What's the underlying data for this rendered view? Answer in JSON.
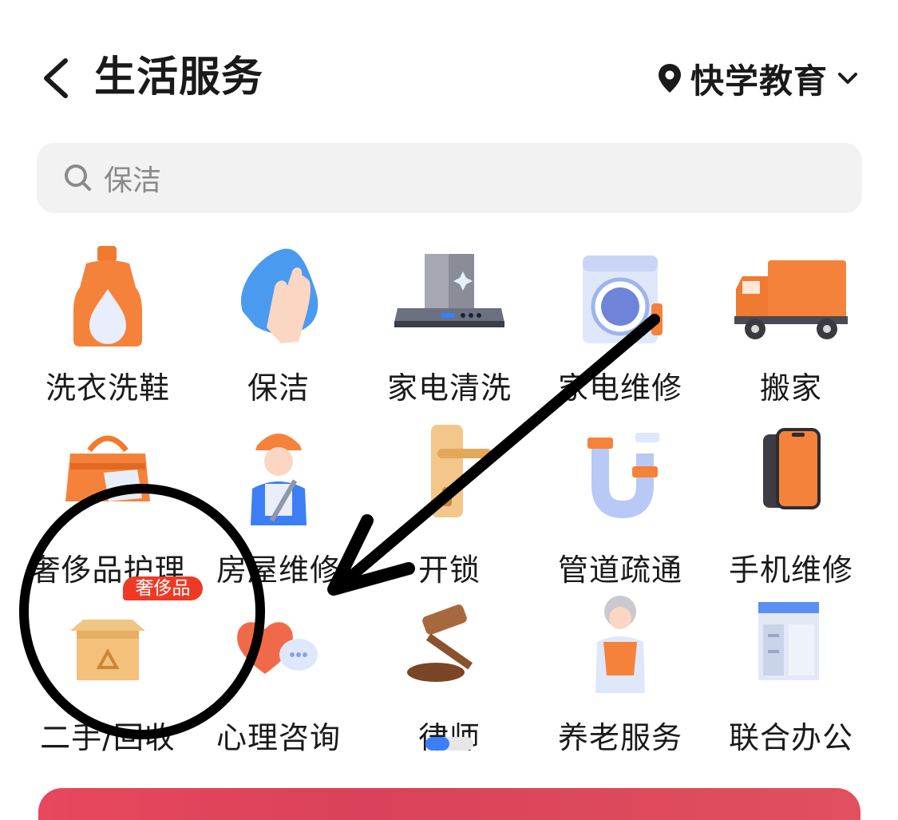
{
  "header": {
    "title": "生活服务",
    "location": "快学教育"
  },
  "search": {
    "placeholder": "保洁"
  },
  "services": [
    {
      "label": "洗衣洗鞋",
      "icon": "detergent-bottle-icon"
    },
    {
      "label": "保洁",
      "icon": "cleaning-cloth-icon"
    },
    {
      "label": "家电清洗",
      "icon": "range-hood-icon"
    },
    {
      "label": "家电维修",
      "icon": "washing-machine-icon"
    },
    {
      "label": "搬家",
      "icon": "moving-truck-icon"
    },
    {
      "label": "奢侈品护理",
      "icon": "handbag-icon"
    },
    {
      "label": "房屋维修",
      "icon": "repair-worker-icon"
    },
    {
      "label": "开锁",
      "icon": "door-lock-icon"
    },
    {
      "label": "管道疏通",
      "icon": "pipe-icon"
    },
    {
      "label": "手机维修",
      "icon": "smartphone-icon"
    },
    {
      "label": "二手/回收",
      "icon": "recycle-box-icon",
      "badge": "奢侈品"
    },
    {
      "label": "心理咨询",
      "icon": "heart-chat-icon"
    },
    {
      "label": "律师",
      "icon": "gavel-icon"
    },
    {
      "label": "养老服务",
      "icon": "elderly-person-icon"
    },
    {
      "label": "联合办公",
      "icon": "office-desk-icon"
    }
  ],
  "pagination": {
    "pages": 2,
    "current": 1
  },
  "colors": {
    "accent": "#3b7ef6",
    "badge": "#ee3a24",
    "orange": "#f5823a",
    "blue": "#6f9af5"
  }
}
